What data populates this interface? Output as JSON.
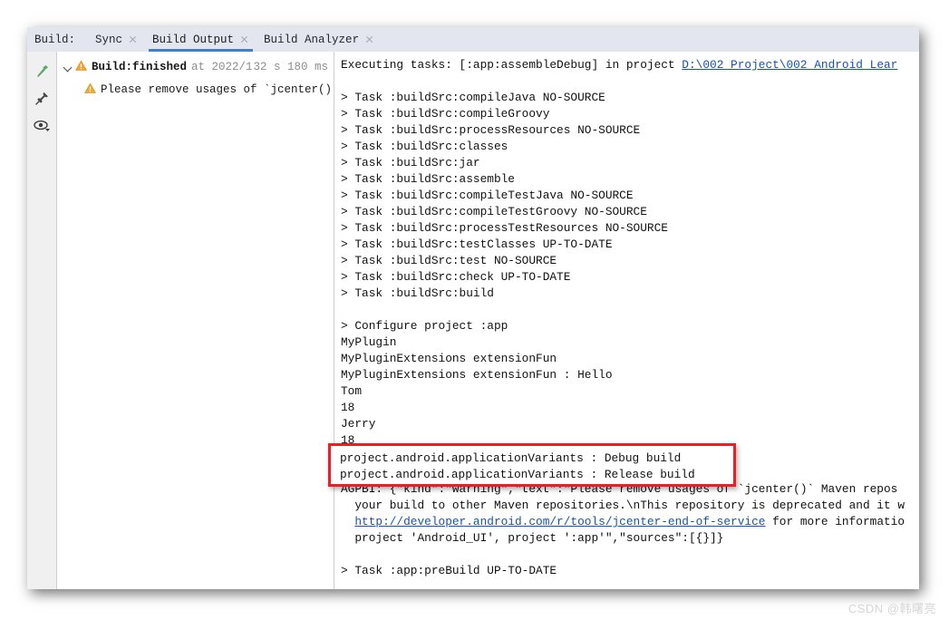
{
  "window": {
    "tab_caption": "Build:",
    "tabs": [
      {
        "label": "Sync",
        "active": false,
        "closable": true
      },
      {
        "label": "Build Output",
        "active": true,
        "closable": true
      },
      {
        "label": "Build Analyzer",
        "active": false,
        "closable": true
      }
    ]
  },
  "gutter": {
    "icons": [
      {
        "name": "hammer-icon",
        "color": "#59a869"
      },
      {
        "name": "pin-icon",
        "color": "#4a4a4a"
      },
      {
        "name": "eye-icon",
        "color": "#3c3c3c"
      }
    ]
  },
  "tree": {
    "rows": [
      {
        "icon": "warning-icon",
        "strong": "Build:",
        "text": " finished",
        "dim": "at 2022/1",
        "time": "32 s 180 ms"
      },
      {
        "icon": "warning-icon",
        "text": "Please remove usages of `jcenter()"
      }
    ]
  },
  "console": {
    "lines": [
      {
        "text": "Executing tasks: [:app:assembleDebug] in project ",
        "link": "D:\\002 Project\\002 Android Lear"
      },
      {
        "text": ""
      },
      {
        "text": "> Task :buildSrc:compileJava NO-SOURCE"
      },
      {
        "text": "> Task :buildSrc:compileGroovy"
      },
      {
        "text": "> Task :buildSrc:processResources NO-SOURCE"
      },
      {
        "text": "> Task :buildSrc:classes"
      },
      {
        "text": "> Task :buildSrc:jar"
      },
      {
        "text": "> Task :buildSrc:assemble"
      },
      {
        "text": "> Task :buildSrc:compileTestJava NO-SOURCE"
      },
      {
        "text": "> Task :buildSrc:compileTestGroovy NO-SOURCE"
      },
      {
        "text": "> Task :buildSrc:processTestResources NO-SOURCE"
      },
      {
        "text": "> Task :buildSrc:testClasses UP-TO-DATE"
      },
      {
        "text": "> Task :buildSrc:test NO-SOURCE"
      },
      {
        "text": "> Task :buildSrc:check UP-TO-DATE"
      },
      {
        "text": "> Task :buildSrc:build"
      },
      {
        "text": ""
      },
      {
        "text": "> Configure project :app"
      },
      {
        "text": "MyPlugin"
      },
      {
        "text": "MyPluginExtensions extensionFun"
      },
      {
        "text": "MyPluginExtensions extensionFun : Hello"
      },
      {
        "text": "Tom"
      },
      {
        "text": "18"
      },
      {
        "text": "Jerry"
      },
      {
        "text": "18"
      },
      {
        "text": "project.android.applicationVariants : Debug build"
      },
      {
        "text": "project.android.applicationVariants : Release build"
      },
      {
        "text": "AGPBI: {\"kind\":\"warning\",\"text\":\"Please remove usages of `jcenter()` Maven repos"
      },
      {
        "text": "  your build to other Maven repositories.\\nThis repository is deprecated and it w"
      },
      {
        "text": "  ",
        "link": "http://developer.android.com/r/tools/jcenter-end-of-service",
        "after": " for more informatio"
      },
      {
        "text": "  project 'Android_UI', project ':app'\",\"sources\":[{}]}"
      },
      {
        "text": ""
      },
      {
        "text": "> Task :app:preBuild UP-TO-DATE"
      }
    ]
  },
  "annotation": {
    "lines": [
      "project.android.applicationVariants : Debug build",
      "project.android.applicationVariants : Release build"
    ],
    "border_color": "#ee1c25"
  },
  "watermark": {
    "text": "CSDN @韩曙亮"
  }
}
